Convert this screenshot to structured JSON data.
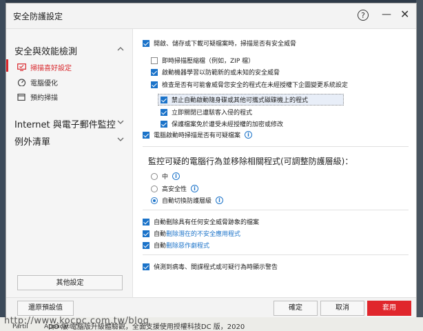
{
  "window": {
    "title": "安全防護設定",
    "help_symbol": "?",
    "min_symbol": "—",
    "close_symbol": "✕"
  },
  "sidebar": {
    "section1": "安全與效能檢測",
    "items": [
      {
        "label": "掃描喜好設定",
        "active": true
      },
      {
        "label": "電腦優化",
        "active": false
      },
      {
        "label": "預約掃描",
        "active": false
      }
    ],
    "section2": "Internet 與電子郵件監控",
    "section3": "例外清單",
    "other_button": "其他設定"
  },
  "content": {
    "opt1": "開啟、儲存或下載可疑檔案時，掃描是否有安全威脅",
    "opt1a": "即時掃描壓縮檔（例如，ZIP 檔）",
    "opt1b": "啟動機器學習以防範新的或未知的安全威脅",
    "opt1c": "檢查是否有可能會威脅您安全的程式在未經授權下企圖變更系統設定",
    "opt1c1": "禁止自動啟動隨身碟或其他可攜式磁碟機上的程式",
    "opt1c2": "立即關閉已遭駭客入侵的程式",
    "opt1c3": "保護檔案免於遭受未經授權的加密或修改",
    "opt2": "電腦啟動時掃描是否有可疑檔案",
    "heading": "監控可疑的電腦行為並移除相關程式(可調整防護層級)：",
    "radio1": "中",
    "radio2": "高安全性",
    "radio3": "自動切換防護層級",
    "del1": "自動刪除具有任何安全威脅跡象的檔案",
    "del2_prefix": "自動",
    "del2_link": "刪除潛在的不安全應用程式",
    "del3_prefix": "自動",
    "del3_link": "刪除惡作劇程式",
    "alert": "偵測到病毒、間諜程式或可疑行為時顯示警告",
    "info_symbol": "i"
  },
  "footer": {
    "reset": "還原預設值",
    "ok": "確定",
    "cancel": "取消",
    "apply": "套用"
  },
  "background": {
    "watermark": "http://www.kocpc.com.tw/blog",
    "bottom_text": "DO 版 電腦版升級體驗觀，全面支援使用授權科技DC 版，2020",
    "bottom_label1": "Partil",
    "bottom_label2": "Applicati"
  },
  "colors": {
    "accent": "#1b73c9",
    "danger": "#e0262c"
  }
}
